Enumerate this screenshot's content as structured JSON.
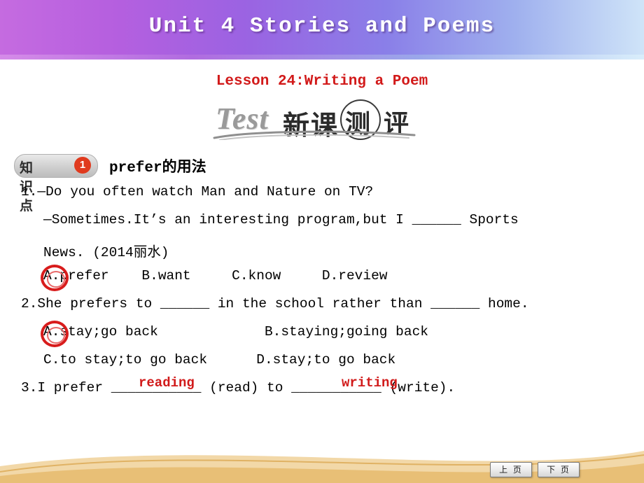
{
  "header": {
    "title": "Unit 4  Stories and Poems"
  },
  "lesson": {
    "title": "Lesson 24:Writing a Poem"
  },
  "logo": {
    "test_word": "Test",
    "cn_part1": "新课",
    "cn_part2": "测",
    "cn_part3": "评"
  },
  "knowledge_point": {
    "badge_label": "知识点",
    "number": "1",
    "title": "prefer的用法"
  },
  "questions": {
    "q1_line1": "1.—Do you often watch Man and Nature on TV?",
    "q1_line2": "—Sometimes.It’s an interesting program,but I ______ Sports",
    "q1_line3": "News. (2014丽水)",
    "q1_options": "A.prefer    B.want     C.know     D.review",
    "q2_line1": "2.She prefers to ______ in the school rather than ______ home.",
    "q2_options_row1": "A.stay;go back             B.staying;going back",
    "q2_options_row2": "C.to stay;to go back      D.stay;to go back",
    "q3_line1": "3.I prefer ___________ (read) to ___________ (write)."
  },
  "answers": {
    "q3_blank1": "reading",
    "q3_blank2": "writing"
  },
  "nav": {
    "prev_label": "上 页",
    "next_label": "下 页"
  },
  "colors": {
    "title_red": "#d21a1a",
    "answer_red": "#d11a1a",
    "badge_red": "#e03a1e",
    "banner_start": "#c56be0",
    "banner_end": "#cfe4f8"
  }
}
